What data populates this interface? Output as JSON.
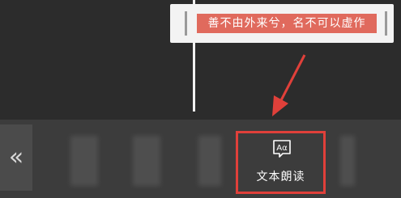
{
  "popup": {
    "selected_text": "善不由外来兮，名不可以虚作"
  },
  "toolbar": {
    "back_glyph": "«",
    "read_aloud_label": "文本朗读",
    "read_aloud_icon_glyph": "Aα"
  },
  "colors": {
    "highlight": "#e06a5d",
    "callout": "#e0403a",
    "toolbar_bg": "#3c3c3c",
    "page_bg": "#2c2c2c"
  },
  "icons": [
    "double-chevron-left-icon",
    "text-read-aloud-icon",
    "pointer-arrow-icon"
  ]
}
